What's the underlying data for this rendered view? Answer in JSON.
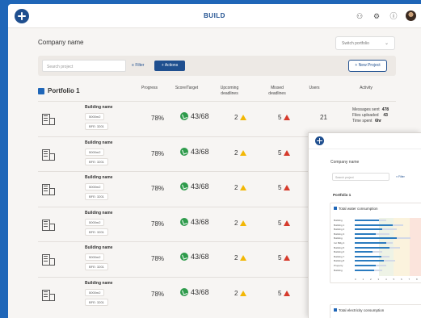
{
  "header": {
    "title": "BUILD",
    "icons": [
      "people-icon",
      "gear-icon",
      "help-icon",
      "avatar"
    ]
  },
  "company": "Company name",
  "switch_portfolio": "Switch portfolio",
  "toolbar": {
    "search_placeholder": "Search project",
    "filter_label": "Filter",
    "actions_label": "Actions",
    "new_project_label": "New Project"
  },
  "table": {
    "portfolio_title": "Portfolio 1",
    "columns": {
      "progress": "Progress",
      "score": "Score/Target",
      "upcoming": "Upcoming deadlines",
      "missed": "Missed deadlines",
      "users": "Users",
      "activity": "Activity"
    },
    "rows": [
      {
        "name": "Building name",
        "area": "5000m2",
        "bfe": "BFE: 3201",
        "progress": "78%",
        "score": "43/68",
        "upcoming": "2",
        "missed": "5",
        "users": "21",
        "activity": {
          "messages_label": "Messages sent",
          "messages": "478",
          "files_label": "Files uploaded",
          "files": "43",
          "time_label": "Time spent",
          "time": "6hr"
        }
      },
      {
        "name": "Building name",
        "area": "5000m2",
        "bfe": "BFE: 3201",
        "progress": "78%",
        "score": "43/68",
        "upcoming": "2",
        "missed": "5"
      },
      {
        "name": "Building name",
        "area": "5000m2",
        "bfe": "BFE: 3201",
        "progress": "78%",
        "score": "43/68",
        "upcoming": "2",
        "missed": "5"
      },
      {
        "name": "Building name",
        "area": "5000m2",
        "bfe": "BFE: 3201",
        "progress": "78%",
        "score": "43/68",
        "upcoming": "2",
        "missed": "5"
      },
      {
        "name": "Building name",
        "area": "5000m2",
        "bfe": "BFE: 3201",
        "progress": "78%",
        "score": "43/68",
        "upcoming": "2",
        "missed": "5"
      },
      {
        "name": "Building name",
        "area": "5000m2",
        "bfe": "BFE: 3201",
        "progress": "78%",
        "score": "43/68",
        "upcoming": "2",
        "missed": "5"
      }
    ]
  },
  "overlay": {
    "company": "Company name",
    "search_placeholder": "Search project",
    "filter_label": "Filter",
    "portfolio_title": "Portfolio 1",
    "card1_title": "Total water consumption",
    "card1_rows": [
      {
        "label": "Building",
        "fill": 0.35,
        "mark": 0.45
      },
      {
        "label": "Building 1",
        "fill": 0.55,
        "mark": 0.7
      },
      {
        "label": "Building 2",
        "fill": 0.4,
        "mark": 0.6
      },
      {
        "label": "Building 3",
        "fill": 0.3,
        "mark": 0.5
      },
      {
        "label": "Building",
        "fill": 0.6,
        "mark": 0.8
      },
      {
        "label": "1st Bldg 4",
        "fill": 0.45,
        "mark": 0.55
      },
      {
        "label": "Building 5",
        "fill": 0.5,
        "mark": 0.65
      },
      {
        "label": "Building 6",
        "fill": 0.25,
        "mark": 0.4
      },
      {
        "label": "Building 7",
        "fill": 0.38,
        "mark": 0.5
      },
      {
        "label": "Building 8",
        "fill": 0.42,
        "mark": 0.58
      },
      {
        "label": "Property",
        "fill": 0.3,
        "mark": 0.45
      },
      {
        "label": "Building",
        "fill": 0.28,
        "mark": 0.4
      }
    ],
    "card1_axis": [
      "0",
      "1",
      "2",
      "3",
      "4",
      "5",
      "6",
      "7",
      "8",
      "9"
    ],
    "card2_title": "Total electricity consumption"
  },
  "colors": {
    "brand": "#1f4f8f",
    "accent_blue": "#1f66b8",
    "green": "#2e9b4b",
    "warning": "#f2b705",
    "alert": "#d63a2b"
  }
}
